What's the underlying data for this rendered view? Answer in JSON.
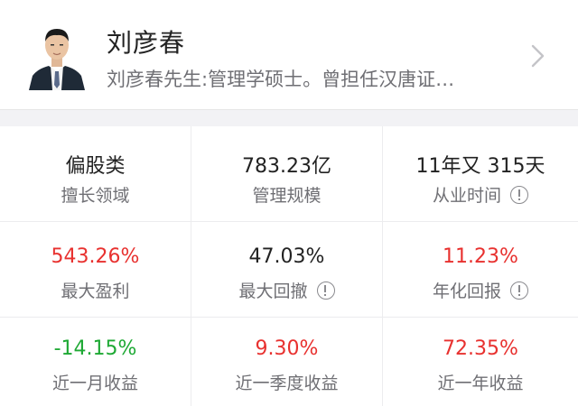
{
  "profile": {
    "name": "刘彦春",
    "bio": "刘彦春先生:管理学硕士。曾担任汉唐证…",
    "avatar_icon": "manager-portrait",
    "chevron_icon": "chevron-right-icon"
  },
  "colors": {
    "positive": "#e8312f",
    "negative": "#1ea934",
    "neutral": "#222222"
  },
  "stats": [
    {
      "value": "偏股类",
      "label": "擅长领域",
      "info": false,
      "tone": "neutral"
    },
    {
      "value": "783.23亿",
      "label": "管理规模",
      "info": false,
      "tone": "neutral"
    },
    {
      "value": "11年又 315天",
      "label": "从业时间",
      "info": true,
      "tone": "neutral"
    },
    {
      "value": "543.26%",
      "label": "最大盈利",
      "info": false,
      "tone": "positive"
    },
    {
      "value": "47.03%",
      "label": "最大回撤",
      "info": true,
      "tone": "neutral"
    },
    {
      "value": "11.23%",
      "label": "年化回报",
      "info": true,
      "tone": "positive"
    },
    {
      "value": "-14.15%",
      "label": "近一月收益",
      "info": false,
      "tone": "negative"
    },
    {
      "value": "9.30%",
      "label": "近一季度收益",
      "info": false,
      "tone": "positive"
    },
    {
      "value": "72.35%",
      "label": "近一年收益",
      "info": false,
      "tone": "positive"
    }
  ]
}
